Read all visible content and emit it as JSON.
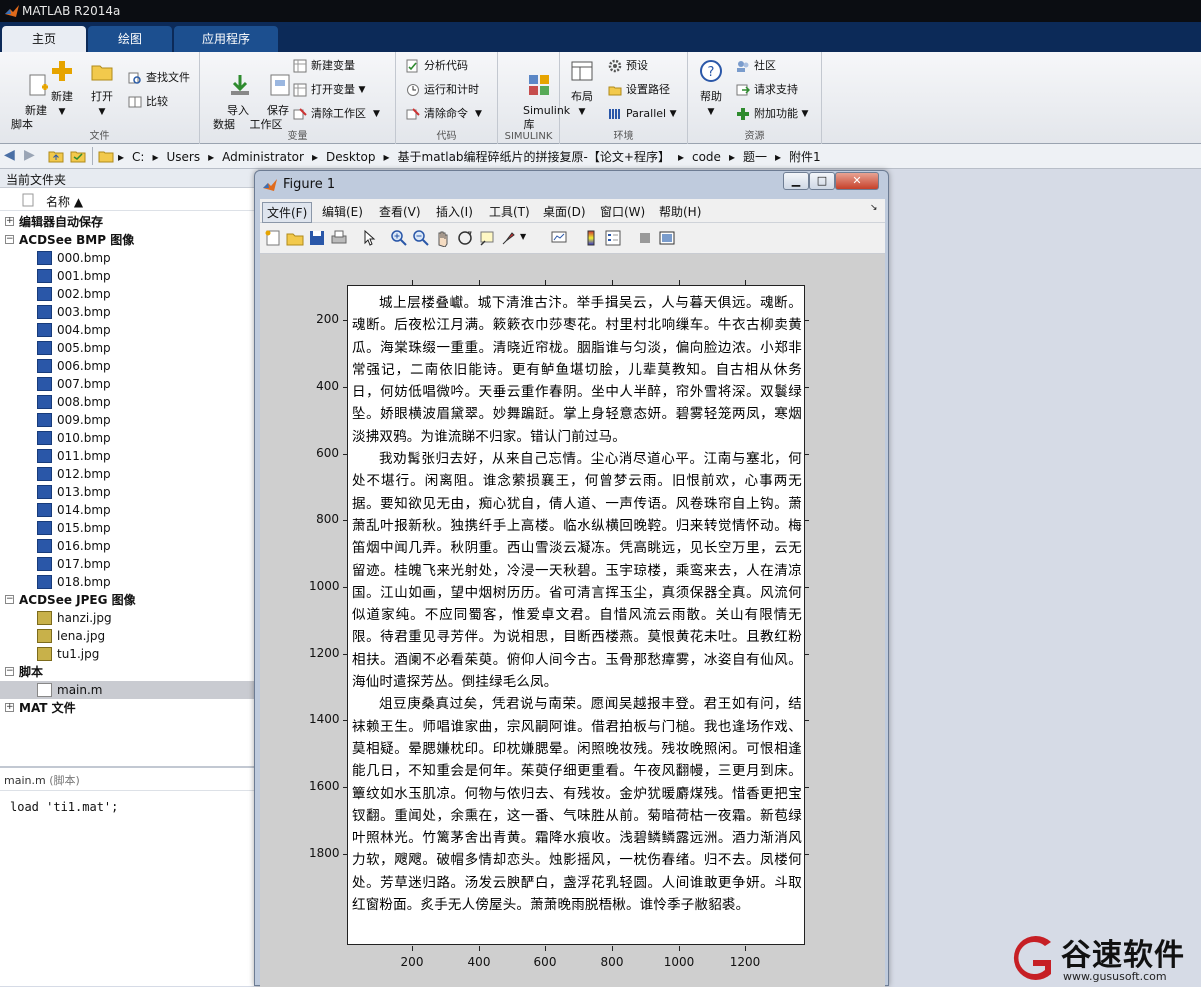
{
  "app": {
    "title": "MATLAB R2014a"
  },
  "tabs": [
    {
      "label": "主页"
    },
    {
      "label": "绘图"
    },
    {
      "label": "应用程序"
    }
  ],
  "ribbon": {
    "groups": {
      "file": "文件",
      "variable": "变量",
      "code": "代码",
      "simulink": "SIMULINK",
      "env": "环境",
      "resources": "资源"
    },
    "new_script": "新建\n脚本",
    "new": "新建",
    "open": "打开",
    "find_files": "查找文件",
    "compare": "比较",
    "import": "导入\n数据",
    "save": "保存\n工作区",
    "new_var": "新建变量",
    "open_var": "打开变量",
    "clear_ws": "清除工作区",
    "analyze": "分析代码",
    "run_time": "运行和计时",
    "clear_cmd": "清除命令",
    "simulink": "Simulink\n库",
    "layout": "布局",
    "prefs": "预设",
    "set_path": "设置路径",
    "parallel": "Parallel",
    "help": "帮助",
    "community": "社区",
    "request_support": "请求支持",
    "addons": "附加功能"
  },
  "address": {
    "crumbs": [
      "C:",
      "Users",
      "Administrator",
      "Desktop",
      "基于matlab编程碎纸片的拼接复原-【论文+程序】",
      "code",
      "题一",
      "附件1"
    ]
  },
  "current_folder": {
    "title": "当前文件夹",
    "col_name": "名称 ▲",
    "groups": [
      {
        "label": "编辑器自动保存"
      },
      {
        "label": "ACDSee BMP 图像"
      },
      {
        "label": "ACDSee JPEG 图像"
      },
      {
        "label": "脚本"
      },
      {
        "label": "MAT 文件"
      }
    ],
    "bmp_files": [
      "000.bmp",
      "001.bmp",
      "002.bmp",
      "003.bmp",
      "004.bmp",
      "005.bmp",
      "006.bmp",
      "007.bmp",
      "008.bmp",
      "009.bmp",
      "010.bmp",
      "011.bmp",
      "012.bmp",
      "013.bmp",
      "014.bmp",
      "015.bmp",
      "016.bmp",
      "017.bmp",
      "018.bmp"
    ],
    "jpg_files": [
      "hanzi.jpg",
      "lena.jpg",
      "tu1.jpg"
    ],
    "script_files": [
      "main.m"
    ]
  },
  "detail": {
    "title": "main.m",
    "subtitle": "(脚本)",
    "code": "load 'ti1.mat';"
  },
  "figure": {
    "title": "Figure 1",
    "menu": [
      "文件(F)",
      "编辑(E)",
      "查看(V)",
      "插入(I)",
      "工具(T)",
      "桌面(D)",
      "窗口(W)",
      "帮助(H)"
    ],
    "y_ticks": [
      "200",
      "400",
      "600",
      "800",
      "1000",
      "1200",
      "1400",
      "1600",
      "1800"
    ],
    "x_ticks": [
      "200",
      "400",
      "600",
      "800",
      "1000",
      "1200"
    ],
    "paragraphs": [
      "城上层楼叠巘。城下清淮古汴。举手揖吴云，人与暮天俱远。魂断。魂断。后夜松江月满。簌簌衣巾莎枣花。村里村北响缫车。牛衣古柳卖黄瓜。海棠珠缀一重重。清晓近帘栊。胭脂谁与匀淡，偏向脸边浓。小郑非常强记，二南依旧能诗。更有鲈鱼堪切脍，儿辈莫教知。自古相从休务日，何妨低唱微吟。天垂云重作春阴。坐中人半醉，帘外雪将深。双鬟绿坠。娇眼横波眉黛翠。妙舞蹁跹。掌上身轻意态妍。碧雾轻笼两凤，寒烟淡拂双鸦。为谁流睇不归家。错认门前过马。",
      "我劝髯张归去好，从来自己忘情。尘心消尽道心平。江南与塞北，何处不堪行。闲离阻。谁念萦损襄王，何曾梦云雨。旧恨前欢，心事两无据。要知欲见无由，痴心犹自，倩人道、一声传语。风卷珠帘自上钩。萧萧乱叶报新秋。独携纤手上高楼。临水纵横回晚鞚。归来转觉情怀动。梅笛烟中闻几弄。秋阴重。西山雪淡云凝冻。凭高眺远，见长空万里，云无留迹。桂魄飞来光射处，冷浸一天秋碧。玉宇琼楼，乘鸾来去，人在清凉国。江山如画，望中烟树历历。省可清言挥玉尘，真须保器全真。风流何似道家纯。不应同蜀客，惟爱卓文君。自惜风流云雨散。关山有限情无限。待君重见寻芳伴。为说相思，目断西楼燕。莫恨黄花未吐。且教红粉相扶。酒阑不必看茱萸。俯仰人间今古。玉骨那愁瘴雾，冰姿自有仙风。海仙时遣探芳丛。倒挂绿毛么凤。",
      "俎豆庚桑真过矣，凭君说与南荣。愿闻吴越报丰登。君王如有问，结袜赖王生。师唱谁家曲，宗风嗣阿谁。借君拍板与门槌。我也逢场作戏、莫相疑。晕腮嫌枕印。印枕嫌腮晕。闲照晚妆残。残妆晚照闲。可恨相逢能几日，不知重会是何年。茱萸仔细更重看。午夜风翻幔，三更月到床。簟纹如水玉肌凉。何物与侬归去、有残妆。金炉犹暖麝煤残。惜香更把宝钗翻。重闻处，余熏在，这一番、气味胜从前。菊暗荷枯一夜霜。新苞绿叶照林光。竹篱茅舍出青黄。霜降水痕收。浅碧鳞鳞露远洲。酒力渐消风力软，飕飕。破帽多情却恋头。烛影摇风，一枕伤春绪。归不去。凤楼何处。芳草迷归路。汤发云腴酽白，盏浮花乳轻圆。人间谁敢更争妍。斗取红窗粉面。炙手无人傍屋头。萧萧晚雨脱梧楸。谁怜季子敝貂裘。"
    ]
  },
  "watermark": {
    "brand": "谷速软件",
    "url": "www.gususoft.com"
  }
}
